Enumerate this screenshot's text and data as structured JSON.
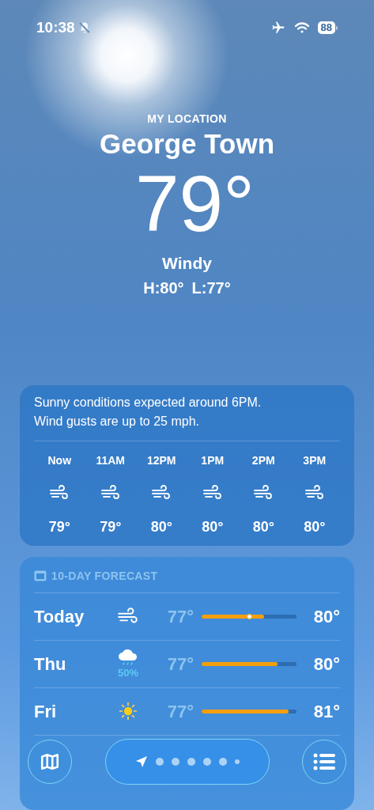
{
  "status_bar": {
    "time": "10:38",
    "silent": true,
    "airplane": true,
    "battery": "88"
  },
  "header": {
    "label": "MY LOCATION",
    "city": "George Town",
    "temperature": "79°",
    "condition": "Windy",
    "high": "H:80°",
    "low": "L:77°"
  },
  "hourly": {
    "summary": "Sunny conditions expected around 6PM. Wind gusts are up to 25 mph.",
    "hours": [
      {
        "time": "Now",
        "kind": "wind",
        "temp": "79°"
      },
      {
        "time": "11AM",
        "kind": "wind",
        "temp": "79°"
      },
      {
        "time": "12PM",
        "kind": "wind",
        "temp": "80°"
      },
      {
        "time": "1PM",
        "kind": "wind",
        "temp": "80°"
      },
      {
        "time": "2PM",
        "kind": "wind",
        "temp": "80°"
      },
      {
        "time": "3PM",
        "kind": "wind",
        "temp": "80°"
      }
    ]
  },
  "forecast": {
    "title": "10-DAY FORECAST",
    "days": [
      {
        "day": "Today",
        "kind": "wind",
        "low": "77°",
        "high": "80°",
        "level": 0.66,
        "current": {
          "level": 0.5
        }
      },
      {
        "day": "Thu",
        "kind": "rain",
        "chance": "50%",
        "low": "77°",
        "high": "80°",
        "level": 0.8
      },
      {
        "day": "Fri",
        "kind": "sun",
        "low": "77°",
        "high": "81°",
        "level": 0.92
      }
    ]
  },
  "bottom_bar": {
    "pages": [
      {
        "kind": "location",
        "selected": true
      },
      {
        "kind": "dot",
        "selected": false
      },
      {
        "kind": "dot",
        "selected": false
      },
      {
        "kind": "dot",
        "selected": false
      },
      {
        "kind": "dot",
        "selected": false
      },
      {
        "kind": "dot",
        "selected": false
      },
      {
        "kind": "small",
        "selected": false
      }
    ]
  }
}
